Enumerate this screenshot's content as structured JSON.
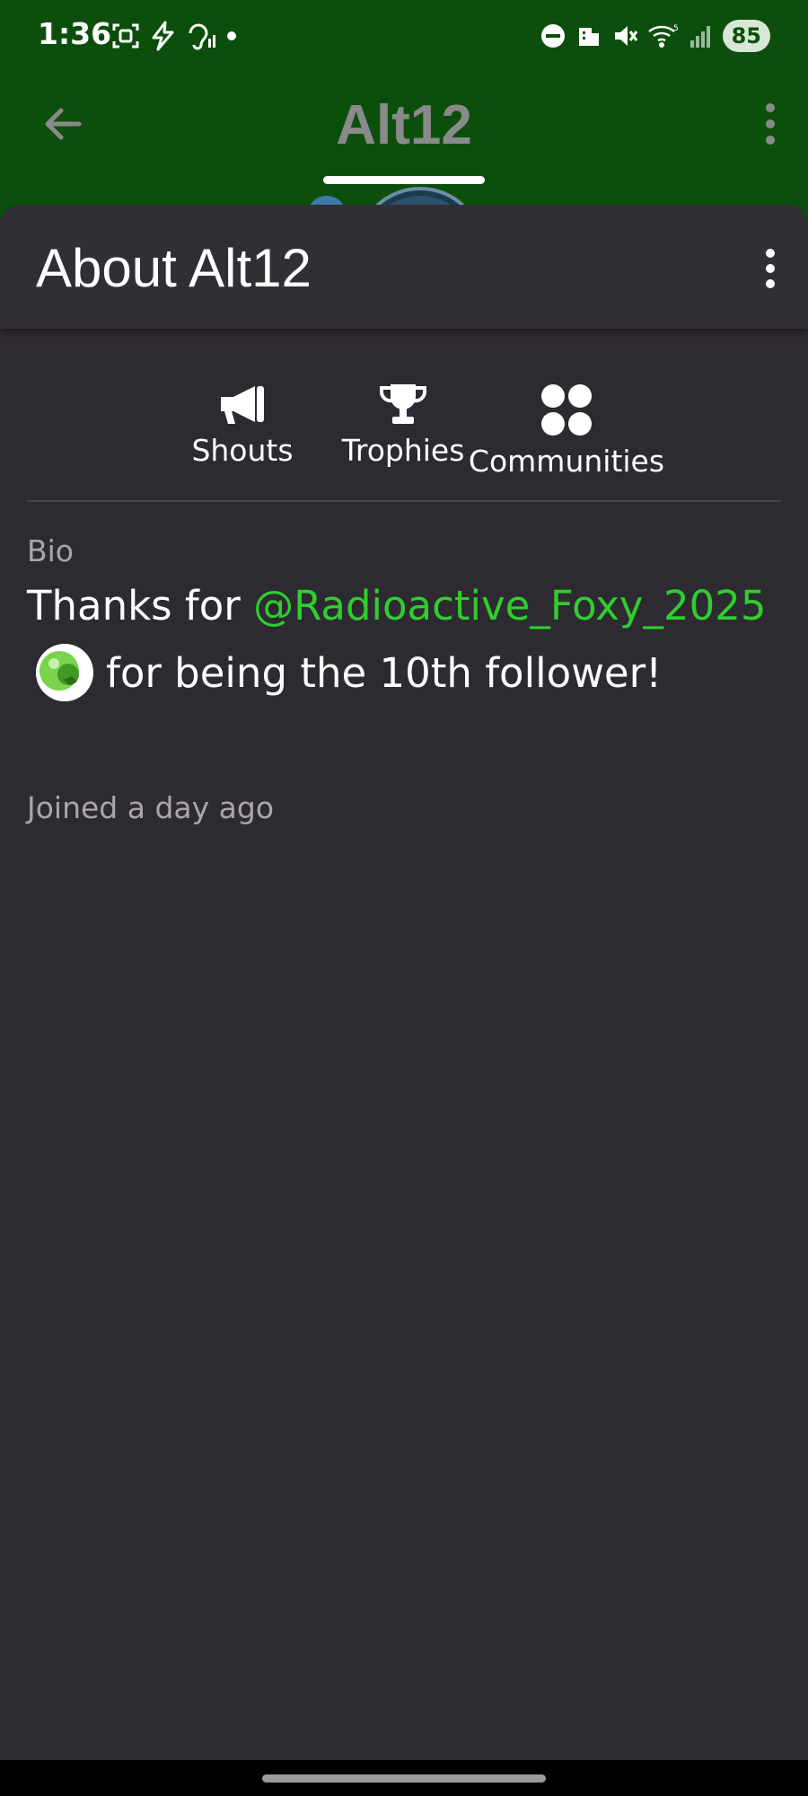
{
  "status_bar": {
    "time": "1:36",
    "battery": "85",
    "wifi_badge": "5"
  },
  "app_bar": {
    "title": "Alt12"
  },
  "sheet": {
    "title": "About Alt12",
    "tabs": [
      {
        "label": "Shouts",
        "icon": "megaphone-icon"
      },
      {
        "label": "Trophies",
        "icon": "trophy-icon"
      },
      {
        "label": "Communities",
        "icon": "communities-icon"
      }
    ],
    "bio_label": "Bio",
    "bio": {
      "prefix": "Thanks for ",
      "mention": "@Radioactive_Foxy_2025",
      "suffix": "for being the 10th follower!"
    },
    "joined": "Joined a day ago"
  },
  "colors": {
    "header_green": "#0c4f0c",
    "sheet_bg": "#2e2a31",
    "mention_green": "#2ecf2e",
    "muted_text": "#a9a6ab"
  }
}
